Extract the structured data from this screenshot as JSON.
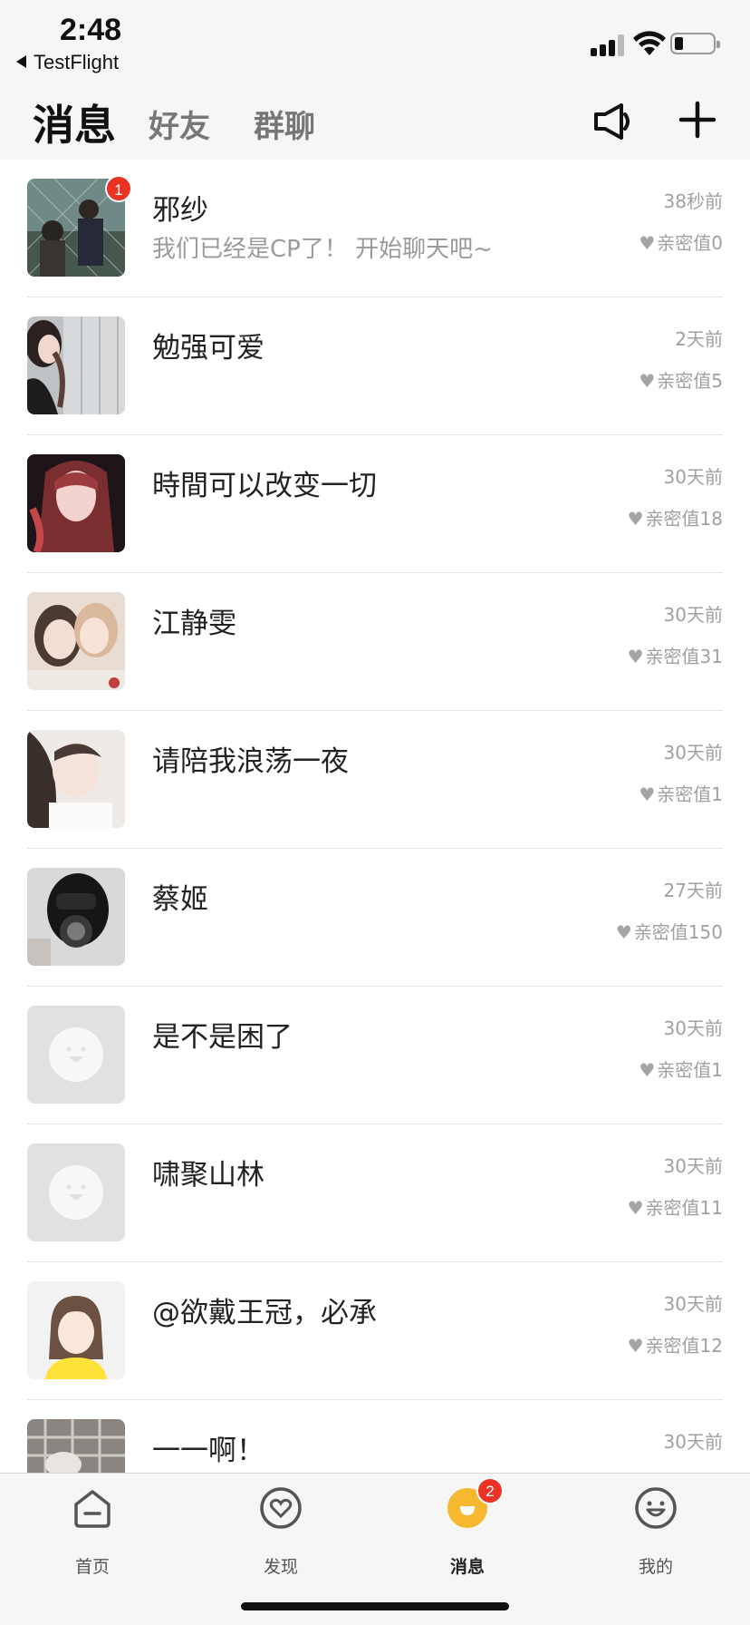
{
  "status_bar": {
    "time": "2:48",
    "back_app": "TestFlight"
  },
  "header": {
    "tabs": [
      {
        "label": "消息",
        "active": true
      },
      {
        "label": "好友",
        "active": false
      },
      {
        "label": "群聊",
        "active": false
      }
    ],
    "icons": [
      "speaker-icon",
      "plus-icon"
    ]
  },
  "conversations": [
    {
      "name": "邪纱",
      "preview": "我们已经是CP了！ 开始聊天吧~",
      "time": "38秒前",
      "intimacy": "亲密值0",
      "unread": "1",
      "avatar": "photo"
    },
    {
      "name": "勉强可爱",
      "preview": "",
      "time": "2天前",
      "intimacy": "亲密值5",
      "unread": "",
      "avatar": "photo"
    },
    {
      "name": "時間可以改变一切",
      "preview": "",
      "time": "30天前",
      "intimacy": "亲密值18",
      "unread": "",
      "avatar": "photo"
    },
    {
      "name": "江静雯",
      "preview": "",
      "time": "30天前",
      "intimacy": "亲密值31",
      "unread": "",
      "avatar": "photo"
    },
    {
      "name": "请陪我浪荡一夜",
      "preview": "",
      "time": "30天前",
      "intimacy": "亲密值1",
      "unread": "",
      "avatar": "photo"
    },
    {
      "name": "蔡姬",
      "preview": "",
      "time": "27天前",
      "intimacy": "亲密值150",
      "unread": "",
      "avatar": "photo"
    },
    {
      "name": "是不是困了",
      "preview": "",
      "time": "30天前",
      "intimacy": "亲密值1",
      "unread": "",
      "avatar": "default"
    },
    {
      "name": "啸聚山林",
      "preview": "",
      "time": "30天前",
      "intimacy": "亲密值11",
      "unread": "",
      "avatar": "default"
    },
    {
      "name": "@欲戴王冠，必承",
      "preview": "",
      "time": "30天前",
      "intimacy": "亲密值12",
      "unread": "",
      "avatar": "cartoon"
    },
    {
      "name": "一一啊！",
      "preview": "",
      "time": "30天前",
      "intimacy": "",
      "unread": "",
      "avatar": "photo"
    }
  ],
  "tabbar": {
    "items": [
      {
        "label": "首页",
        "icon": "home-icon"
      },
      {
        "label": "发现",
        "icon": "heart-circle-icon"
      },
      {
        "label": "消息",
        "icon": "message-icon",
        "active": true,
        "badge": "2"
      },
      {
        "label": "我的",
        "icon": "smile-icon"
      }
    ]
  },
  "colors": {
    "accent": "#f5b82e",
    "badge": "#ea3324",
    "divider": "#e3e3e3"
  }
}
